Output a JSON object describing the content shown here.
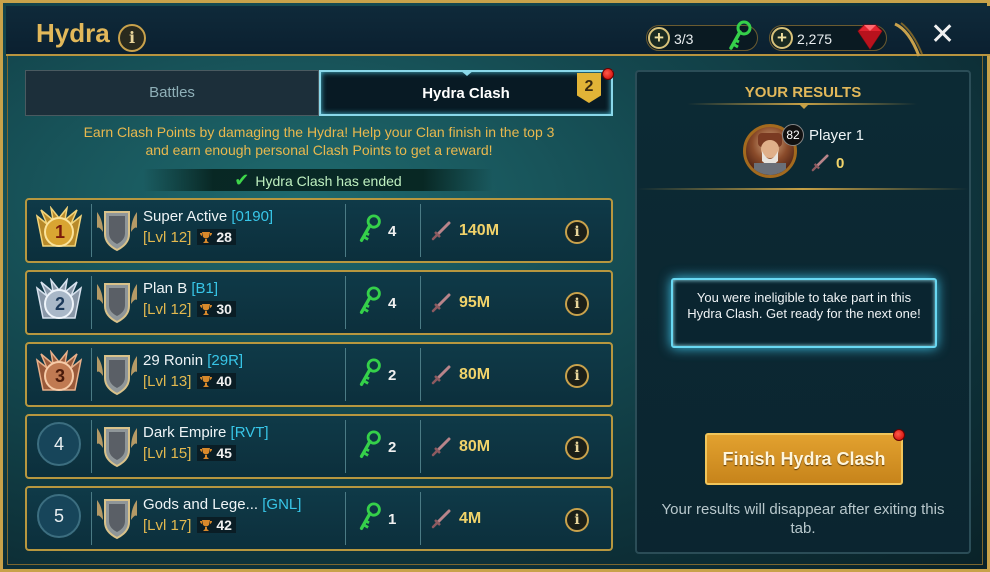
{
  "header": {
    "title": "Hydra",
    "info_icon": "info-icon",
    "keys": "3/3",
    "gems": "2,275",
    "close_icon": "close-icon"
  },
  "tabs": [
    {
      "label": "Battles",
      "active": false
    },
    {
      "label": "Hydra Clash",
      "active": true,
      "badge": "2"
    }
  ],
  "description": {
    "line1": "Earn Clash Points by damaging the Hydra! Help your Clan finish in the top 3",
    "line2": "and earn enough personal Clash Points to get a reward!"
  },
  "status": "Hydra Clash has ended",
  "clans": [
    {
      "rank": "1",
      "name": "Super Active",
      "tag": "[0190]",
      "level": "[Lvl 12]",
      "trophies": "28",
      "keys": "4",
      "damage": "140M"
    },
    {
      "rank": "2",
      "name": "Plan B",
      "tag": "[B1]",
      "level": "[Lvl 12]",
      "trophies": "30",
      "keys": "4",
      "damage": "95M"
    },
    {
      "rank": "3",
      "name": "29 Ronin",
      "tag": "[29R]",
      "level": "[Lvl 13]",
      "trophies": "40",
      "keys": "2",
      "damage": "80M"
    },
    {
      "rank": "4",
      "name": "Dark Empire",
      "tag": "[RVT]",
      "level": "[Lvl 15]",
      "trophies": "45",
      "keys": "2",
      "damage": "80M"
    },
    {
      "rank": "5",
      "name": "Gods and Lege...",
      "tag": "[GNL]",
      "level": "[Lvl 17]",
      "trophies": "42",
      "keys": "1",
      "damage": "4M"
    }
  ],
  "results": {
    "title": "YOUR RESULTS",
    "player_level": "82",
    "player_name": "Player 1",
    "player_points": "0",
    "ineligible_message": "You were ineligible to take part in this Hydra Clash. Get ready for the next one!",
    "finish_button": "Finish Hydra Clash",
    "note": "Your results will disappear after exiting this tab."
  },
  "colors": {
    "gold": "#e2b85a",
    "tag_blue": "#38c6e8",
    "active_tab_border": "#8ad8ea",
    "finish_button": "#d7921f"
  }
}
